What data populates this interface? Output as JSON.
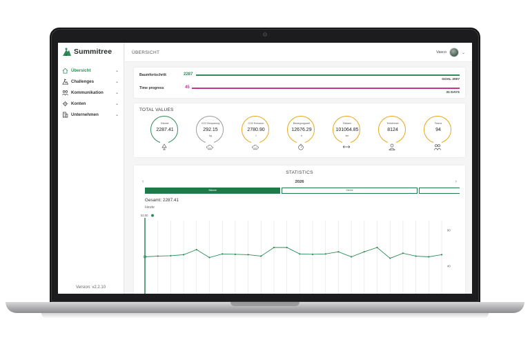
{
  "app": {
    "name": "Summitree",
    "version_label": "Version: v2.2.10"
  },
  "sidebar": {
    "items": [
      {
        "label": "Übersicht",
        "icon": "home-icon",
        "active": true
      },
      {
        "label": "Challenges",
        "icon": "challenges-icon",
        "active": false
      },
      {
        "label": "Kommunikation",
        "icon": "people-icon",
        "active": false
      },
      {
        "label": "Konten",
        "icon": "gear-icon",
        "active": false
      },
      {
        "label": "Unternehmen",
        "icon": "building-icon",
        "active": false
      }
    ]
  },
  "header": {
    "title": "ÜBERSICHT",
    "user_name": "Vasco"
  },
  "progress": {
    "tree": {
      "label": "Baumfortschritt",
      "value": "2287",
      "goal": "GOAL 2007",
      "fraction": 1.0,
      "color": "#2e8b57"
    },
    "time": {
      "label": "Time progress",
      "value": "45",
      "goal": "31 DAYS",
      "fraction": 1.0,
      "color": "#c2338f"
    }
  },
  "totals": {
    "title": "TOTAL VALUES",
    "metrics": [
      {
        "label": "Bäume",
        "value": "2287.41",
        "unit": "",
        "ring_color": "#2e8b57",
        "icon": "tree-icon"
      },
      {
        "label": "CO2 Einsparung",
        "value": "292.15",
        "unit": "kg",
        "ring_color": "#9a9a9a",
        "icon": "co2-cloud-icon"
      },
      {
        "label": "CO2 Emission",
        "value": "2780.90",
        "unit": "t",
        "ring_color": "#e6a817",
        "icon": "co2-cloud-icon"
      },
      {
        "label": "Bewegungszeit",
        "value": "12676.29",
        "unit": "h",
        "ring_color": "#e6a817",
        "icon": "stopwatch-icon"
      },
      {
        "label": "Distanz",
        "value": "101064.85",
        "unit": "km",
        "ring_color": "#e6a817",
        "icon": "arrows-horizontal-icon"
      },
      {
        "label": "Teilnehmer",
        "value": "8124",
        "unit": "",
        "ring_color": "#e6a817",
        "icon": "person-icon"
      },
      {
        "label": "Teams",
        "value": "94",
        "unit": "",
        "ring_color": "#e6a817",
        "icon": "group-icon"
      }
    ]
  },
  "statistics": {
    "title": "STATISTICS",
    "year": "2026",
    "tabs": [
      {
        "label": "Bäume",
        "active": true
      },
      {
        "label": "Steine",
        "active": false
      },
      {
        "label": "",
        "active": false
      }
    ],
    "total_label": "Gesamt: 2287.41",
    "period_label": "Heute",
    "marker_label": "53.00"
  },
  "chart_data": {
    "type": "line",
    "x": [
      1,
      2,
      3,
      4,
      5,
      6,
      7,
      8,
      9,
      10,
      11,
      12,
      13,
      14,
      15,
      16,
      17,
      18,
      19,
      20,
      21,
      22,
      23,
      24
    ],
    "values": [
      53,
      54,
      54.5,
      56,
      63,
      52,
      57,
      56.5,
      56,
      54,
      66,
      66,
      57,
      56.5,
      57,
      60,
      53,
      60,
      66,
      51,
      58,
      54,
      53,
      56
    ],
    "ylim": [
      40,
      90
    ],
    "yticks": [
      "90",
      "40"
    ],
    "grid": true,
    "color": "#2e8b57"
  }
}
